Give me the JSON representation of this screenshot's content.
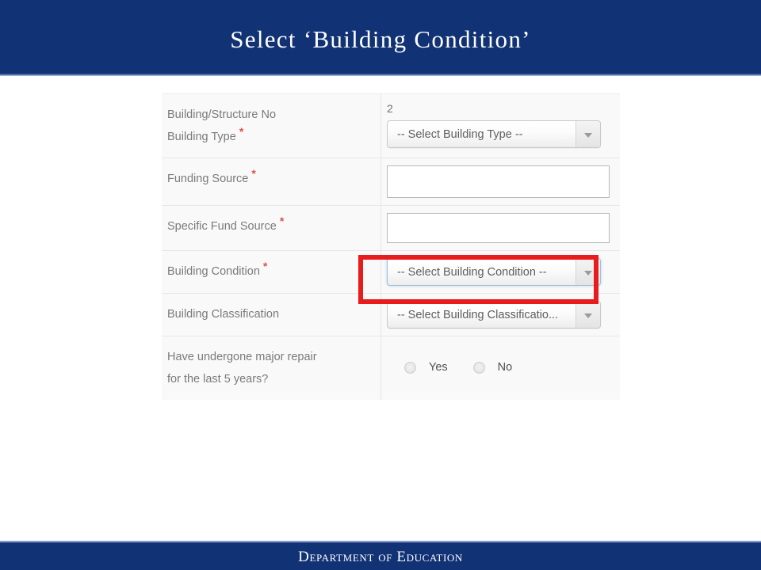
{
  "header": {
    "title": "Select ‘Building Condition’",
    "background_color": "#113274"
  },
  "footer": {
    "title": "Department of Education",
    "background_color": "#113274"
  },
  "form": {
    "required_marker": "*",
    "rows": [
      {
        "labels": [
          "Building/Structure No",
          "Building Type"
        ],
        "required": true,
        "static_value": "2",
        "control": "select",
        "select_value": "-- Select Building Type --"
      },
      {
        "labels": [
          "Funding Source"
        ],
        "required": true,
        "control": "text",
        "text_value": "",
        "placeholder": ""
      },
      {
        "labels": [
          "Specific Fund Source"
        ],
        "required": true,
        "control": "text",
        "text_value": "",
        "placeholder": ""
      },
      {
        "labels": [
          "Building Condition"
        ],
        "required": true,
        "control": "select",
        "select_value": "-- Select Building Condition --",
        "focused": true,
        "highlighted": true
      },
      {
        "labels": [
          "Building Classification"
        ],
        "required": false,
        "control": "select",
        "select_value": "-- Select Building Classificatio..."
      },
      {
        "labels": [
          "Have undergone major repair",
          "for the last 5 years?"
        ],
        "required": false,
        "control": "radio",
        "options": [
          "Yes",
          "No"
        ],
        "selected": null
      }
    ]
  },
  "annotation": {
    "highlight_color": "#e81c1c",
    "target": "building-condition-select"
  }
}
